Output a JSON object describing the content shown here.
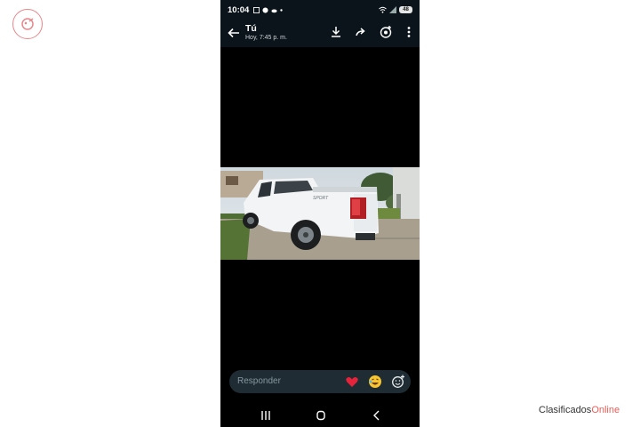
{
  "status_bar": {
    "time": "10:04",
    "battery": "48"
  },
  "header": {
    "title": "Tú",
    "subtitle": "Hoy, 7:45 p. m."
  },
  "media": {
    "vehicle_badge": "SPORT"
  },
  "reply": {
    "placeholder": "Responder",
    "reactions": [
      "❤️",
      "😂"
    ]
  },
  "watermark": {
    "brand": "Clasificados",
    "brand_accent": "Online"
  },
  "colors": {
    "app_bar": "#0b141a",
    "reply_bar": "#1f2c33",
    "accent": "#e8605a"
  }
}
